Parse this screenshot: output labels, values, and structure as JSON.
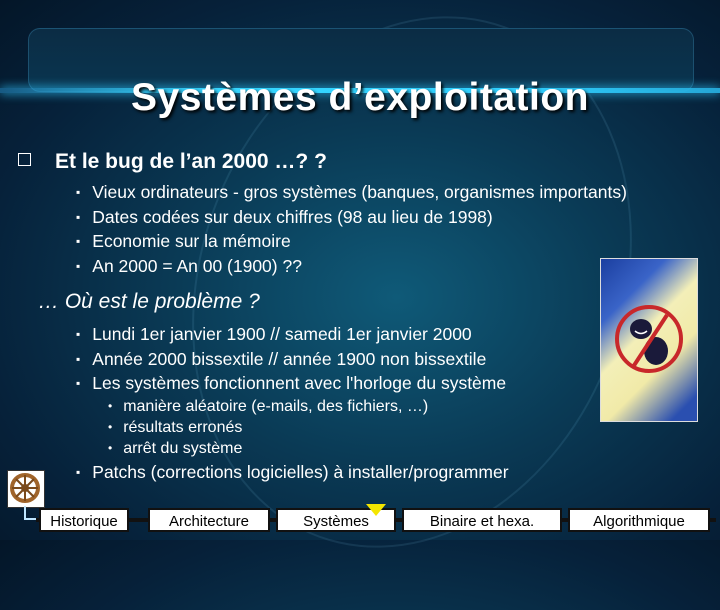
{
  "slide": {
    "title": "Systèmes d’exploitation",
    "section1": {
      "heading": "Et le bug de l’an 2000 …? ?",
      "bullets": [
        "Vieux ordinateurs - gros systèmes (banques, organismes importants)",
        "Dates codées sur deux chiffres (98 au lieu de 1998)",
        "Economie sur la mémoire",
        "An 2000 = An 00 (1900) ??"
      ]
    },
    "section2": {
      "heading": "… Où est le problème ?",
      "bullets": [
        "Lundi 1er janvier 1900 // samedi 1er janvier 2000",
        "Année 2000 bissextile // année 1900 non bissextile",
        "Les systèmes fonctionnent avec l'horloge du système"
      ],
      "sub_bullets": [
        "manière aléatoire (e-mails, des fichiers, …)",
        "résultats erronés",
        "arrêt du système"
      ],
      "last_bullet": "Patchs (corrections logicielles) à installer/programmer"
    }
  },
  "images": {
    "bug": "no-bug-icon",
    "helm": "ship-wheel-icon"
  },
  "nav": {
    "items": [
      "Historique",
      "Architecture",
      "Systèmes",
      "Binaire et hexa.",
      "Algorithmique"
    ],
    "active": "Systèmes",
    "marker_color": "#f4e600"
  }
}
